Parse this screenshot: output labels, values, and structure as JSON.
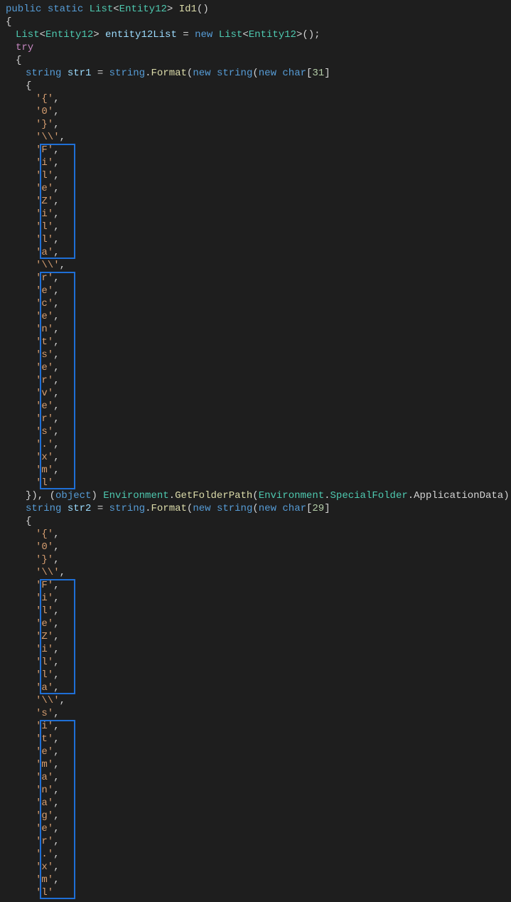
{
  "code": {
    "sig": {
      "public": "public",
      "static": "static",
      "list": "List",
      "entity": "Entity12",
      "method": "Id1",
      "parens": "()"
    },
    "brace_open": "{",
    "brace_close": "}",
    "decl1": {
      "list": "List",
      "entity": "Entity12",
      "var": "entity12List",
      "eq": " = ",
      "new": "new",
      "paren": "();"
    },
    "try": "try",
    "str1": {
      "kw": "string",
      "var": "str1",
      "eq": " = ",
      "stringcls": "string",
      "format": ".Format(",
      "new": "new",
      "stringkw": "string",
      "paren1": "(",
      "new2": "new",
      "charkw": "char",
      "br": "[",
      "n": "31",
      "br2": "]"
    },
    "chars1_pre": [
      "'{'",
      "'0'",
      "'}'",
      "'\\\\'"
    ],
    "chars1_box1": [
      "'F'",
      "'i'",
      "'l'",
      "'e'",
      "'Z'",
      "'i'",
      "'l'",
      "'l'",
      "'a'"
    ],
    "chars1_mid": [
      "'\\\\'"
    ],
    "chars1_box2": [
      "'r'",
      "'e'",
      "'c'",
      "'e'",
      "'n'",
      "'t'",
      "'s'",
      "'e'",
      "'r'",
      "'v'",
      "'e'",
      "'r'",
      "'s'",
      "'.'",
      "'x'",
      "'m'",
      "'l'"
    ],
    "str1_end": {
      "close": "}), (",
      "obj": "object",
      "rest": ") Environment.GetFolderPath(Environment.SpecialFolder.ApplicationData));",
      "env": "Environment",
      "get": "GetFolderPath",
      "sf": "SpecialFolder",
      "ad": "ApplicationData"
    },
    "str2": {
      "kw": "string",
      "var": "str2",
      "eq": " = ",
      "stringcls": "string",
      "format": ".Format(",
      "new": "new",
      "stringkw": "string",
      "paren1": "(",
      "new2": "new",
      "charkw": "char",
      "br": "[",
      "n": "29",
      "br2": "]"
    },
    "chars2_pre": [
      "'{'",
      "'0'",
      "'}'",
      "'\\\\'"
    ],
    "chars2_box1": [
      "'F'",
      "'i'",
      "'l'",
      "'e'",
      "'Z'",
      "'i'",
      "'l'",
      "'l'",
      "'a'"
    ],
    "chars2_mid": [
      "'\\\\'",
      "'s'"
    ],
    "chars2_box2": [
      "'i'",
      "'t'",
      "'e'",
      "'m'",
      "'a'",
      "'n'",
      "'a'",
      "'g'",
      "'e'",
      "'r'",
      "'.'",
      "'x'",
      "'m'",
      "'l'"
    ]
  }
}
